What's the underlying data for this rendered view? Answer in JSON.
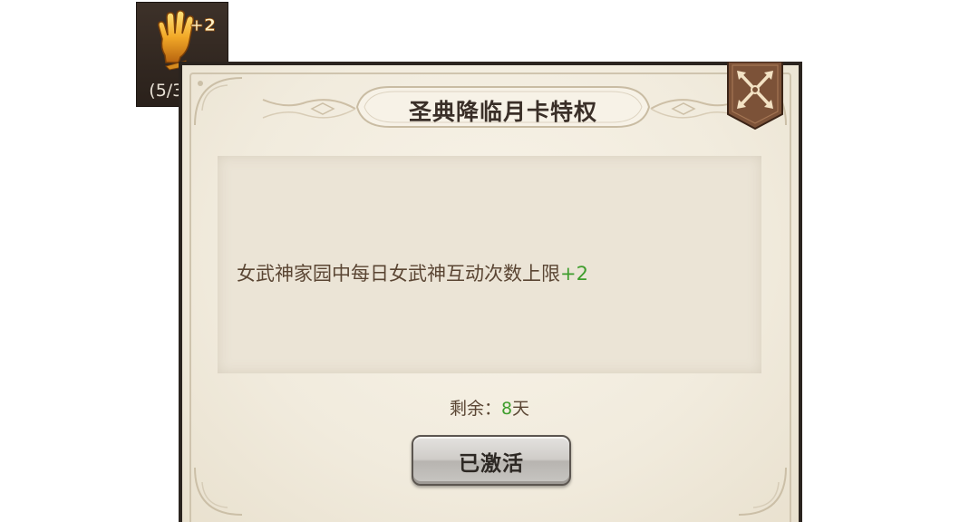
{
  "counter": {
    "icon": "golden-hand-icon",
    "badge": "+2",
    "prefix": "(5/3",
    "bonus": "+2",
    "suffix": ")"
  },
  "dialog": {
    "title": "圣典降临月卡特权",
    "close_icon": "crossed-swords-close-icon",
    "privilege_text": "女武神家园中每日女武神互动次数上限",
    "privilege_bonus": "+2",
    "remaining_label": "剩余：",
    "remaining_value": "8",
    "remaining_unit": "天",
    "button_label": "已激活"
  },
  "colors": {
    "accent_green": "#3e9d2c",
    "text_brown": "#5a4533",
    "frame_dark": "#2b241f",
    "panel_bg": "#f1ebdd"
  }
}
